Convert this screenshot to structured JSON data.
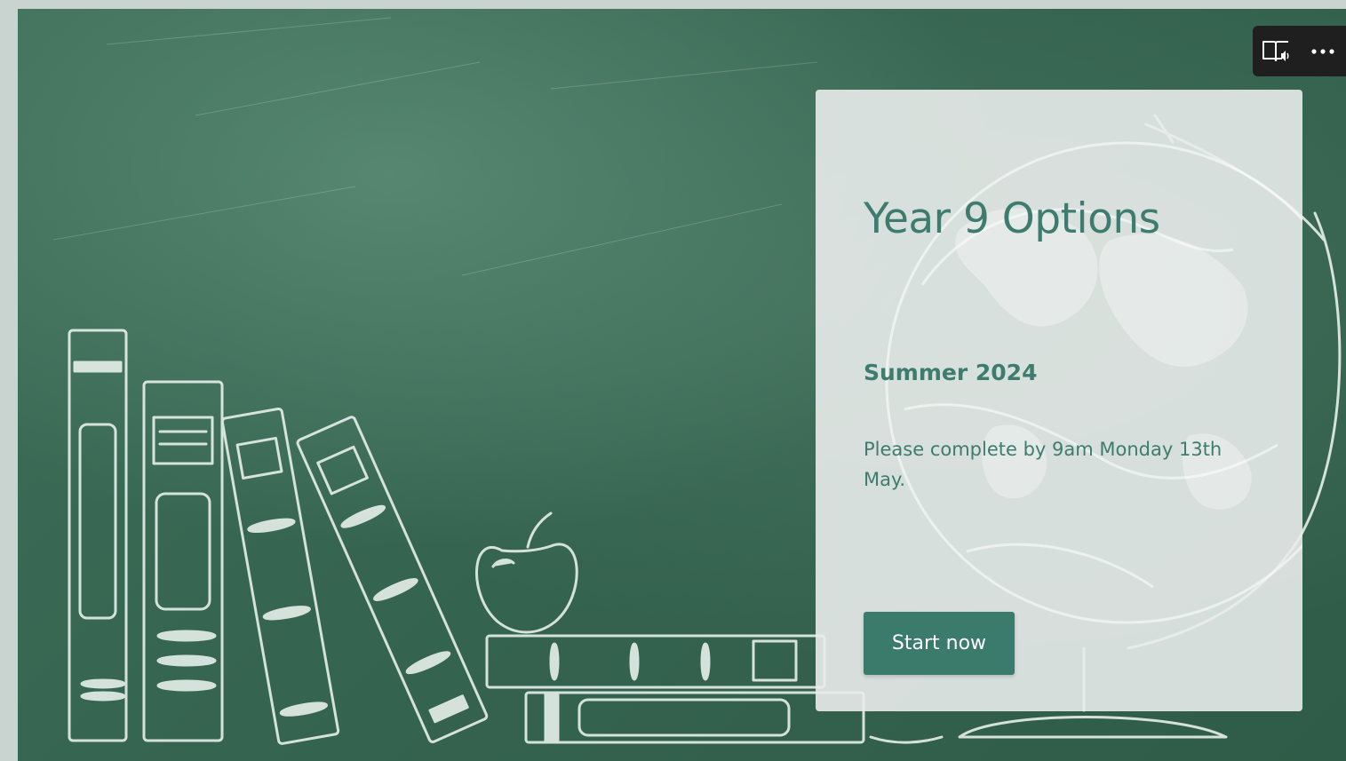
{
  "form": {
    "title": "Year 9 Options",
    "subtitle": "Summer 2024",
    "description": "Please complete by 9am Monday 13th May.",
    "start_label": "Start now"
  },
  "toolbar": {
    "immersive_reader_icon": "immersive-reader-icon",
    "more_icon": "more-options-icon"
  },
  "colors": {
    "accent": "#3b7b6c",
    "title_text": "#3d7c6e",
    "board_green": "#356450",
    "card_background": "#e9eceb",
    "toolbar_background": "#1f1f1f"
  }
}
